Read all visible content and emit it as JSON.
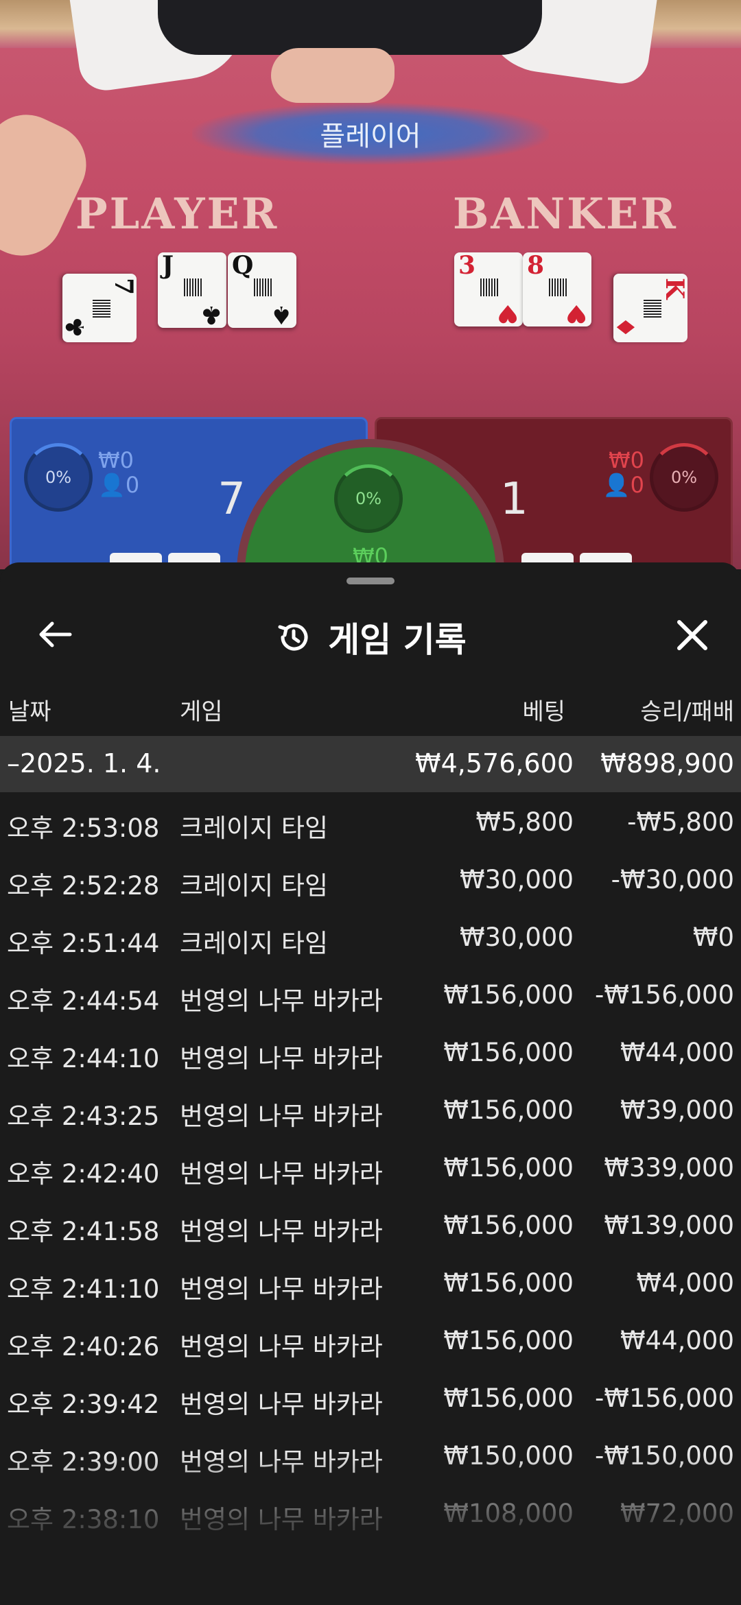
{
  "table": {
    "status_label": "플레이어",
    "player_zone": "PLAYER",
    "banker_zone": "BANKER",
    "player_cards": [
      {
        "rank": "7",
        "suit": "♣"
      },
      {
        "rank": "J",
        "suit": "♣"
      },
      {
        "rank": "Q",
        "suit": "♠"
      }
    ],
    "banker_cards": [
      {
        "rank": "3",
        "suit": "♥"
      },
      {
        "rank": "8",
        "suit": "♥"
      },
      {
        "rank": "K",
        "suit": "♦"
      }
    ],
    "player_panel": {
      "percent": "0%",
      "amount": "₩0",
      "count": "0",
      "score": "7"
    },
    "banker_panel": {
      "percent": "0%",
      "amount": "₩0",
      "count": "0",
      "score": "1"
    },
    "tie_panel": {
      "percent": "0%",
      "amount": "₩0"
    },
    "colors": {
      "player": "#2d55b5",
      "banker": "#6e1d28",
      "tie": "#2f7f33"
    }
  },
  "sheet": {
    "title": "게임 기록",
    "back_icon": "arrow-left-icon",
    "history_icon": "history-icon",
    "close_icon": "close-icon",
    "columns": {
      "date": "날짜",
      "game": "게임",
      "bet": "베팅",
      "result": "승리/패배"
    },
    "date_group": {
      "label": "–2025. 1. 4.",
      "bet_total": "₩4,576,600",
      "result_total": "₩898,900"
    },
    "rows": [
      {
        "time": "오후 2:53:08",
        "game": "크레이지 타임",
        "bet": "₩5,800",
        "result": "-₩5,800"
      },
      {
        "time": "오후 2:52:28",
        "game": "크레이지 타임",
        "bet": "₩30,000",
        "result": "-₩30,000"
      },
      {
        "time": "오후 2:51:44",
        "game": "크레이지 타임",
        "bet": "₩30,000",
        "result": "₩0"
      },
      {
        "time": "오후 2:44:54",
        "game": "번영의 나무 바카라",
        "bet": "₩156,000",
        "result": "-₩156,000"
      },
      {
        "time": "오후 2:44:10",
        "game": "번영의 나무 바카라",
        "bet": "₩156,000",
        "result": "₩44,000"
      },
      {
        "time": "오후 2:43:25",
        "game": "번영의 나무 바카라",
        "bet": "₩156,000",
        "result": "₩39,000"
      },
      {
        "time": "오후 2:42:40",
        "game": "번영의 나무 바카라",
        "bet": "₩156,000",
        "result": "₩339,000"
      },
      {
        "time": "오후 2:41:58",
        "game": "번영의 나무 바카라",
        "bet": "₩156,000",
        "result": "₩139,000"
      },
      {
        "time": "오후 2:41:10",
        "game": "번영의 나무 바카라",
        "bet": "₩156,000",
        "result": "₩4,000"
      },
      {
        "time": "오후 2:40:26",
        "game": "번영의 나무 바카라",
        "bet": "₩156,000",
        "result": "₩44,000"
      },
      {
        "time": "오후 2:39:42",
        "game": "번영의 나무 바카라",
        "bet": "₩156,000",
        "result": "-₩156,000"
      },
      {
        "time": "오후 2:39:00",
        "game": "번영의 나무 바카라",
        "bet": "₩150,000",
        "result": "-₩150,000"
      },
      {
        "time": "오후 2:38:10",
        "game": "번영의 나무 바카라",
        "bet": "₩108,000",
        "result": "₩72,000"
      }
    ]
  }
}
